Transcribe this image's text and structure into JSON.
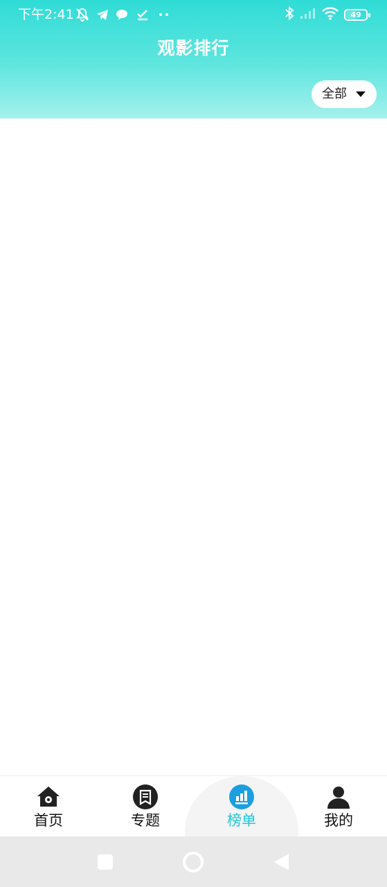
{
  "status_bar": {
    "time": "下午2:41",
    "battery_level": "49",
    "icons": [
      "muted-bell-icon",
      "telegram-icon",
      "chat-bubble-icon",
      "checklist-icon",
      "more-dots-icon",
      "bluetooth-icon",
      "cellular-signal-icon",
      "wifi-icon",
      "battery-icon"
    ]
  },
  "header": {
    "title": "观影排行",
    "filter": {
      "selected": "全部"
    }
  },
  "tabbar": {
    "active_index": 2,
    "items": [
      {
        "label": "首页",
        "icon": "home-icon"
      },
      {
        "label": "专题",
        "icon": "topic-icon"
      },
      {
        "label": "榜单",
        "icon": "ranking-icon"
      },
      {
        "label": "我的",
        "icon": "profile-icon"
      }
    ]
  },
  "colors": {
    "header_top": "#2fdcd6",
    "header_bottom": "#a5f1ec",
    "active_tab": "#22c7d7",
    "active_icon_bg": "#1b9fe0"
  },
  "system_nav": [
    "recent-apps-icon",
    "home-circle-icon",
    "back-triangle-icon"
  ]
}
